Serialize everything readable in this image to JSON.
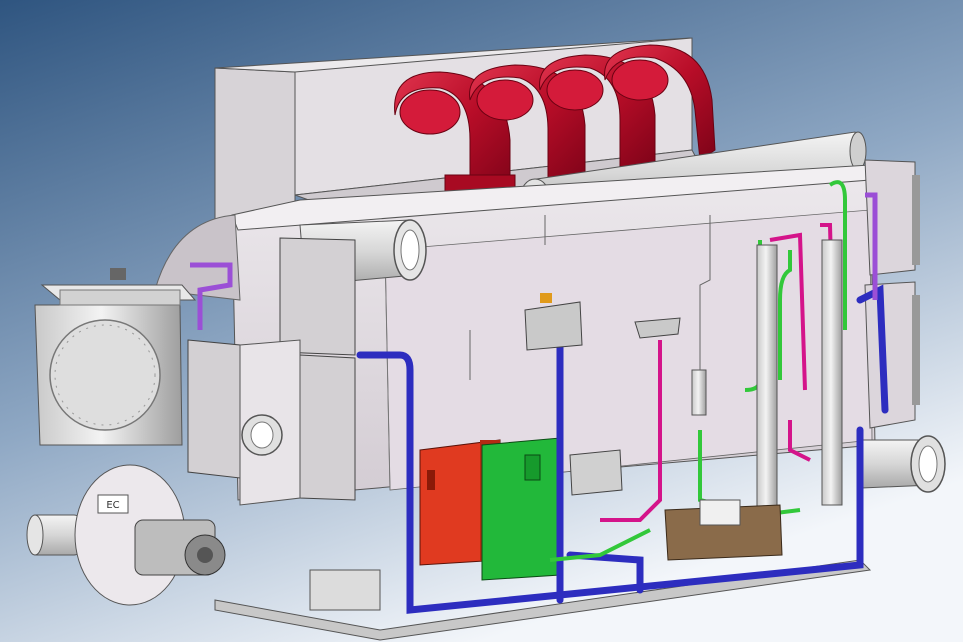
{
  "scene": {
    "kind": "cad-3d-model",
    "subject": "absorption-chiller-unit",
    "colors": {
      "background_top": "#2f5580",
      "background_bottom": "#f3f6fa",
      "body": "#e6e2e6",
      "body_shadow": "#c9c3c9",
      "steel": "#d8d8d8",
      "exhaust_red": "#c8102e",
      "pipe_blue": "#2d2dbf",
      "pipe_green": "#32c83a",
      "pipe_magenta": "#d4148a",
      "pipe_violet": "#9b4fd6",
      "cabinet_red": "#e03a20",
      "cabinet_green": "#22b83a",
      "outline": "#4a4a4a"
    },
    "icons": [
      "gear-icon",
      "valve-icon",
      "gauge-icon"
    ],
    "printed_text": {
      "burner_badge": "EC"
    }
  }
}
